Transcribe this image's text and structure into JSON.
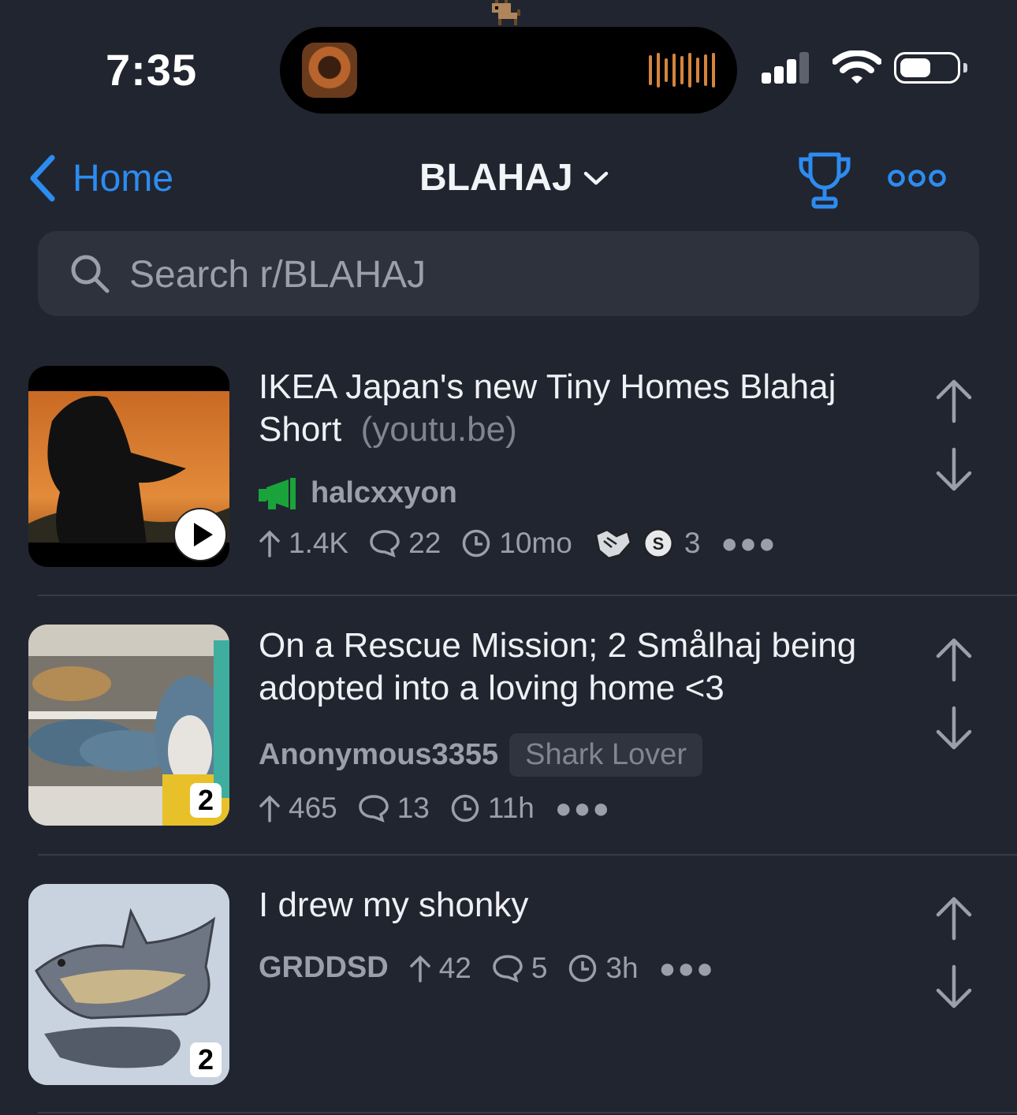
{
  "status_bar": {
    "time": "7:35"
  },
  "nav": {
    "back_label": "Home",
    "title": "BLAHAJ"
  },
  "search": {
    "placeholder": "Search r/BLAHAJ"
  },
  "posts": [
    {
      "title": "IKEA Japan's new Tiny Homes Blahaj Short",
      "domain": "(youtu.be)",
      "author": "halcxxyon",
      "author_icon": "megaphone-icon",
      "upvotes": "1.4K",
      "comments": "22",
      "age": "10mo",
      "awards_count": "3",
      "thumbnail_type": "video"
    },
    {
      "title": "On a Rescue Mission; 2 Smålhaj being adopted into a loving home <3",
      "author": "Anonymous3355",
      "flair": "Shark Lover",
      "upvotes": "465",
      "comments": "13",
      "age": "11h",
      "gallery_count": "2"
    },
    {
      "title": "I drew my shonky",
      "author": "GRDDSD",
      "upvotes": "42",
      "comments": "5",
      "age": "3h",
      "gallery_count": "2"
    }
  ],
  "colors": {
    "accent": "#2d8cf0",
    "background": "#212530",
    "mod_green": "#1aa33a"
  }
}
